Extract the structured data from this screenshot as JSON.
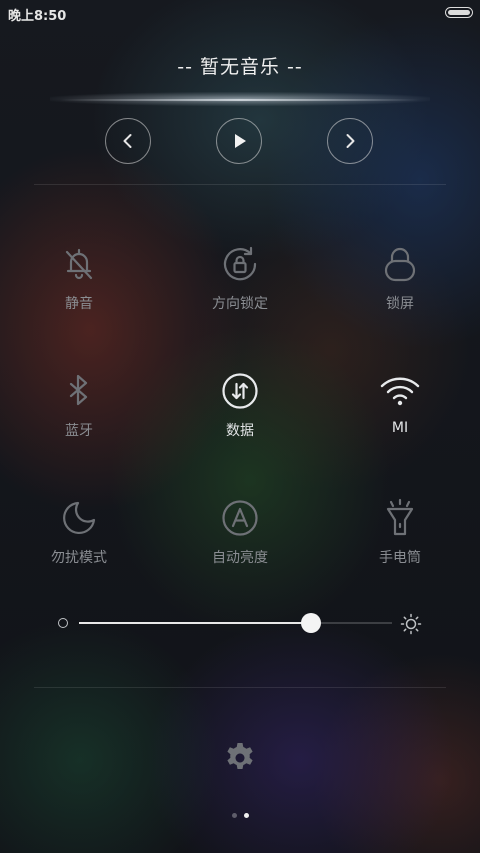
{
  "status_bar": {
    "time": "晚上8:50",
    "battery_level": 1.0
  },
  "music": {
    "title": "-- 暂无音乐 --",
    "prev_icon": "chevron-left-icon",
    "play_icon": "play-icon",
    "next_icon": "chevron-right-icon"
  },
  "toggles": [
    {
      "label": "静音",
      "icon": "bell-off-icon",
      "active": false
    },
    {
      "label": "方向锁定",
      "icon": "rotation-lock-icon",
      "active": false
    },
    {
      "label": "锁屏",
      "icon": "lock-icon",
      "active": false
    },
    {
      "label": "蓝牙",
      "icon": "bluetooth-icon",
      "active": false
    },
    {
      "label": "数据",
      "icon": "mobile-data-icon",
      "active": true
    },
    {
      "label": "MI",
      "icon": "wifi-icon",
      "active": true
    },
    {
      "label": "勿扰模式",
      "icon": "moon-icon",
      "active": false
    },
    {
      "label": "自动亮度",
      "icon": "auto-brightness-icon",
      "active": false
    },
    {
      "label": "手电筒",
      "icon": "flashlight-icon",
      "active": false
    }
  ],
  "brightness": {
    "level": 0.74,
    "min_icon": "brightness-low-icon",
    "max_icon": "sun-icon"
  },
  "settings_icon": "gear-icon",
  "pager": {
    "pages": 2,
    "current": 2
  },
  "colors": {
    "active_text": "#e2e4e6",
    "inactive_text": "#8a8d92",
    "active_icon": "#e8eaec",
    "inactive_icon": "#6e7176"
  }
}
